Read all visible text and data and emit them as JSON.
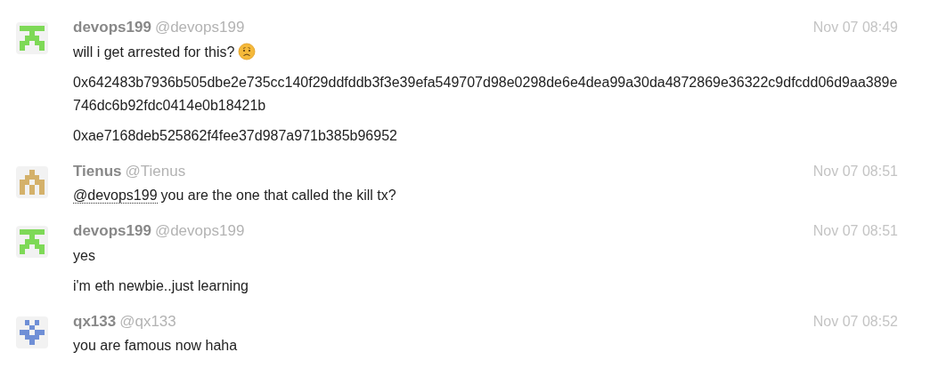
{
  "messages": [
    {
      "avatar": {
        "kind": "tee",
        "color": "#7ed957"
      },
      "name": "devops199",
      "handle": "@devops199",
      "time": "Nov 07 08:49",
      "lines": [
        {
          "text": "will i get arrested for this?",
          "emoji": true
        },
        {
          "text": "0x642483b7936b505dbe2e735cc140f29ddfddb3f3e39efa549707d98e0298de6e4dea99a30da4872869e36322c9dfcdd06d9aa389e746dc6b92fdc0414e0b18421b"
        },
        {
          "text": "0xae7168deb525862f4fee37d987a971b385b96952"
        }
      ]
    },
    {
      "avatar": {
        "kind": "arch",
        "color": "#d4b16a"
      },
      "name": "Tienus",
      "handle": "@Tienus",
      "time": "Nov 07 08:51",
      "lines": [
        {
          "mention": "@devops199",
          "text": "you are the one that called the kill tx?"
        }
      ]
    },
    {
      "avatar": {
        "kind": "tee",
        "color": "#7ed957"
      },
      "name": "devops199",
      "handle": "@devops199",
      "time": "Nov 07 08:51",
      "lines": [
        {
          "text": "yes"
        },
        {
          "text": "i'm eth newbie..just learning"
        }
      ]
    },
    {
      "avatar": {
        "kind": "cross",
        "color": "#6f8fd6"
      },
      "name": "qx133",
      "handle": "@qx133",
      "time": "Nov 07 08:52",
      "lines": [
        {
          "text": "you are famous now haha"
        }
      ]
    }
  ]
}
